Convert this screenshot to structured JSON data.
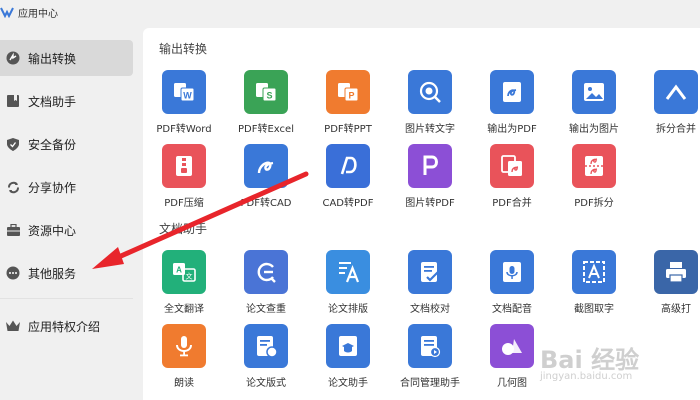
{
  "app": {
    "title": "应用中心"
  },
  "sidebar": {
    "items": [
      {
        "label": "输出转换",
        "icon": "convert-icon",
        "active": true
      },
      {
        "label": "文档助手",
        "icon": "bookmark-icon"
      },
      {
        "label": "安全备份",
        "icon": "shield-icon"
      },
      {
        "label": "分享协作",
        "icon": "share-icon"
      },
      {
        "label": "资源中心",
        "icon": "briefcase-icon"
      },
      {
        "label": "其他服务",
        "icon": "more-icon"
      },
      {
        "label": "应用特权介绍",
        "icon": "crown-icon"
      }
    ]
  },
  "main": {
    "sections": [
      {
        "title": "输出转换",
        "tools": [
          {
            "label": "PDF转Word",
            "color": "#3a78d8",
            "icon": "pdf-to-word-icon"
          },
          {
            "label": "PDF转Excel",
            "color": "#3aa356",
            "icon": "pdf-to-excel-icon"
          },
          {
            "label": "PDF转PPT",
            "color": "#f07b2f",
            "icon": "pdf-to-ppt-icon"
          },
          {
            "label": "图片转文字",
            "color": "#3a78d8",
            "icon": "image-to-text-icon"
          },
          {
            "label": "输出为PDF",
            "color": "#3a78d8",
            "icon": "export-pdf-icon"
          },
          {
            "label": "输出为图片",
            "color": "#3a78d8",
            "icon": "export-image-icon"
          },
          {
            "label": "拆分合并",
            "color": "#3a78d8",
            "icon": "split-merge-icon"
          },
          {
            "label": "PDF压缩",
            "color": "#e9535a",
            "icon": "pdf-compress-icon"
          },
          {
            "label": "PDF转CAD",
            "color": "#3a78d8",
            "icon": "pdf-to-cad-icon"
          },
          {
            "label": "CAD转PDF",
            "color": "#3a6fd8",
            "icon": "cad-to-pdf-icon"
          },
          {
            "label": "图片转PDF",
            "color": "#8c4fd6",
            "icon": "image-to-pdf-icon"
          },
          {
            "label": "PDF合并",
            "color": "#e9535a",
            "icon": "pdf-merge-icon"
          },
          {
            "label": "PDF拆分",
            "color": "#e9535a",
            "icon": "pdf-split-icon"
          }
        ]
      },
      {
        "title": "文档助手",
        "tools": [
          {
            "label": "全文翻译",
            "color": "#22b07a",
            "icon": "translate-icon"
          },
          {
            "label": "论文查重",
            "color": "#4a74d6",
            "icon": "plagiarism-icon"
          },
          {
            "label": "论文排版",
            "color": "#3a8ee0",
            "icon": "typeset-icon"
          },
          {
            "label": "文档校对",
            "color": "#3a78d8",
            "icon": "proofread-icon"
          },
          {
            "label": "文档配音",
            "color": "#3a78d8",
            "icon": "voiceover-icon"
          },
          {
            "label": "截图取字",
            "color": "#3a78d8",
            "icon": "screenshot-ocr-icon"
          },
          {
            "label": "高级打",
            "color": "#3a66a8",
            "icon": "print-icon"
          },
          {
            "label": "朗读",
            "color": "#f07b2f",
            "icon": "read-aloud-icon"
          },
          {
            "label": "论文版式",
            "color": "#3a78d8",
            "icon": "paper-format-icon"
          },
          {
            "label": "论文助手",
            "color": "#3a78d8",
            "icon": "paper-assistant-icon"
          },
          {
            "label": "合同管理助手",
            "color": "#3a78d8",
            "icon": "contract-icon"
          },
          {
            "label": "几何图",
            "color": "#8c4fd6",
            "icon": "geometry-icon"
          }
        ]
      }
    ]
  },
  "watermark": {
    "text": "Bai 经验",
    "sub": "jingyan.baidu.com"
  }
}
